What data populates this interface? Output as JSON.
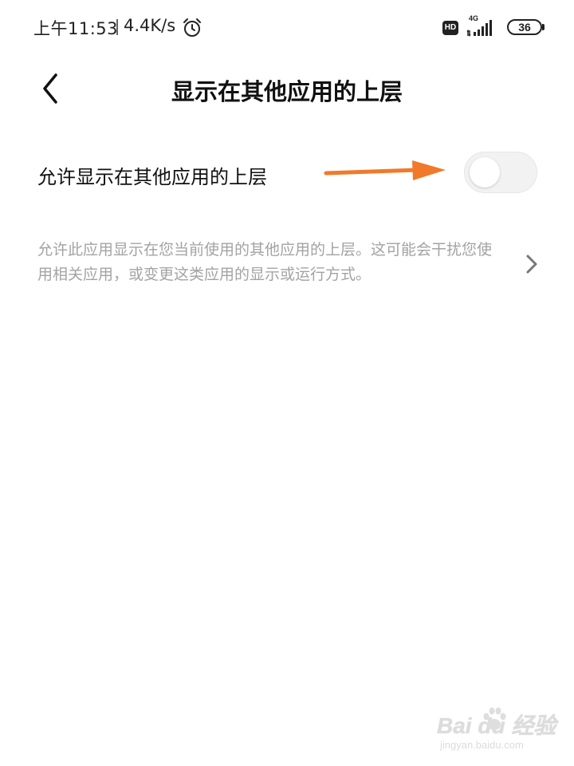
{
  "status_bar": {
    "time": "上午11:53",
    "net_speed": "4.4K/s",
    "alarm_icon": "alarm-clock-icon",
    "hd_badge": "HD",
    "network_type": "4G",
    "signal_icon": "cell-signal-icon",
    "battery_level": "36"
  },
  "header": {
    "back_icon": "chevron-left-icon",
    "title": "显示在其他应用的上层"
  },
  "setting": {
    "label": "允许显示在其他应用的上层",
    "toggle_on": false,
    "annotation_color": "#f07a2a"
  },
  "description": {
    "text": "允许此应用显示在您当前使用的其他应用的上层。这可能会干扰您使用相关应用，或变更这类应用的显示或运行方式。",
    "chevron_icon": "chevron-right-icon"
  },
  "watermark": {
    "brand": "Bai du 经验",
    "url": "jingyan.baidu.com"
  }
}
